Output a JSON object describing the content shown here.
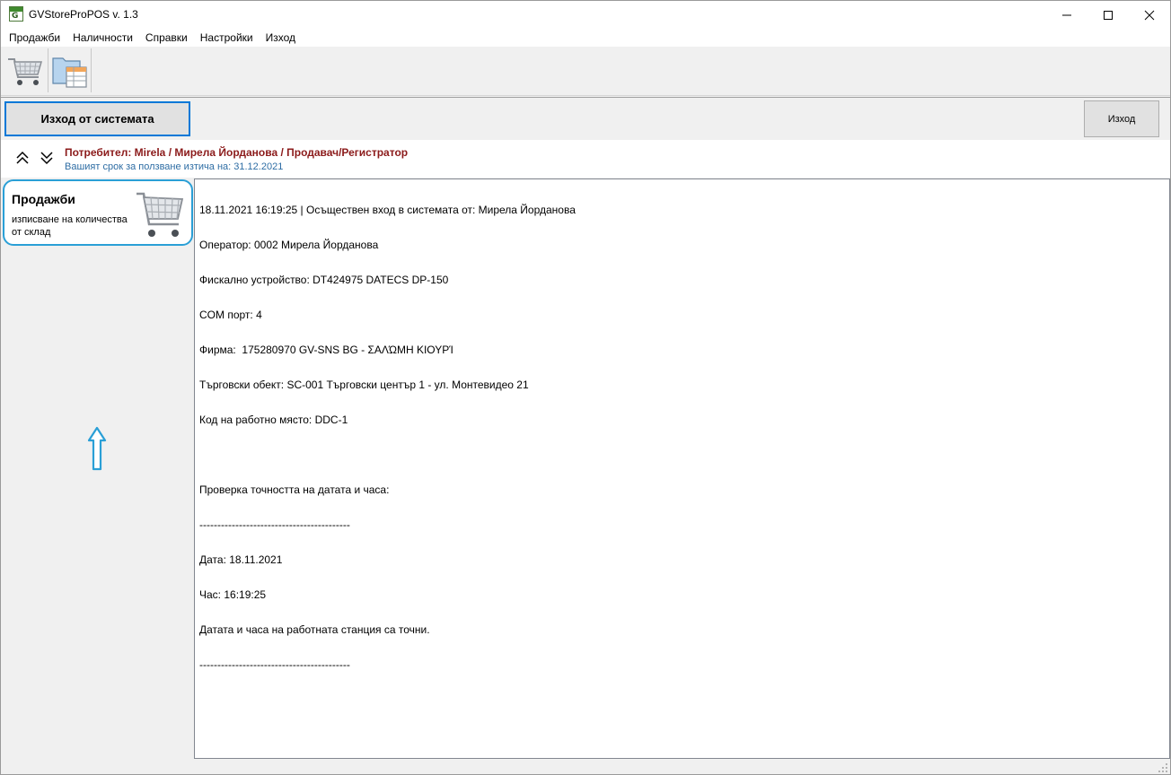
{
  "window": {
    "title": "GVStoreProPOS v. 1.3",
    "icon": "app-logo-icon",
    "controls": [
      "minimize-icon",
      "maximize-icon",
      "close-icon"
    ]
  },
  "menu": {
    "items": [
      {
        "label": "Продажби"
      },
      {
        "label": "Наличности"
      },
      {
        "label": "Справки"
      },
      {
        "label": "Настройки"
      },
      {
        "label": "Изход"
      }
    ]
  },
  "toolbar": {
    "buttons": [
      {
        "icon": "shopping-cart-icon"
      },
      {
        "icon": "folder-table-icon"
      }
    ]
  },
  "actions": {
    "exit_system_label": "Изход от системата",
    "exit_label": "Изход"
  },
  "userbar": {
    "user_text": "Потребител: Mirela / Мирела Йорданова / Продавач/Регистратор",
    "expiry_text": "Вашият срок за ползване изтича на: 31.12.2021",
    "icons": [
      "chevron-up-double-icon",
      "chevron-down-double-icon"
    ]
  },
  "tile": {
    "title": "Продажби",
    "description": "изписване на количества от склад",
    "icon": "shopping-cart-icon"
  },
  "log": {
    "lines": [
      "18.11.2021 16:19:25 | Осъществен вход в системата от: Мирела Йорданова",
      "Оператор: 0002 Мирела Йорданова",
      "Фискално устройство: DT424975 DATECS DP-150",
      "COM порт: 4",
      "Фирма:  175280970 GV-SNS BG - ΣΑΛΏΜΗ ΚΙΟΥΡΊ",
      "Търговски обект: SC-001 Търговски център 1 - ул. Монтевидео 21",
      "Код на работно място: DDC-1",
      "",
      "Проверка точността на датата и часа:",
      "------------------------------------------",
      "Дата: 18.11.2021",
      "Час: 16:19:25",
      "Датата и часа на работната станция са точни.",
      "------------------------------------------"
    ]
  },
  "colors": {
    "focus_blue": "#0078d7",
    "tile_border": "#2a9fd6",
    "user_red": "#8b1a1a",
    "expiry_blue": "#2e6da4"
  }
}
